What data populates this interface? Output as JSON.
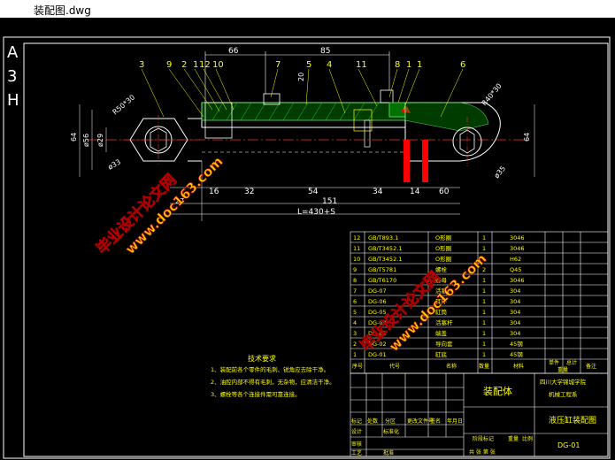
{
  "window": {
    "title": "装配图.dwg"
  },
  "sheet": {
    "format_letters": [
      "A",
      "3",
      "H"
    ]
  },
  "balloons": [
    "3",
    "9",
    "2",
    "1",
    "12",
    "10",
    "7",
    "5",
    "4",
    "11",
    "8",
    "1",
    "1",
    "6"
  ],
  "dimensions": {
    "d66": "66",
    "d85": "85",
    "d20": "20",
    "r_left": "R50*30",
    "r_right": "R40*30",
    "d64_left": "64",
    "d56": "ø56",
    "d29": "ø29",
    "d33": "ø33",
    "d64_right": "64",
    "d35": "ø35",
    "b27": "27",
    "b16": "16",
    "b32": "32",
    "b54": "54",
    "b34": "34",
    "b14": "14",
    "b60": "60",
    "d151": "151",
    "total": "L=430+S"
  },
  "watermark": {
    "line1": "毕业设计论文网",
    "line2": "www.doc163.com"
  },
  "parts_table": {
    "rows": [
      {
        "no": "12",
        "code": "GB/T893.1",
        "name": "O形圈",
        "qty": "1",
        "mat": "3046"
      },
      {
        "no": "11",
        "code": "GB/T3452.1",
        "name": "O形圈",
        "qty": "1",
        "mat": "3046"
      },
      {
        "no": "10",
        "code": "GB/T3452.1",
        "name": "O形圈",
        "qty": "1",
        "mat": "H62"
      },
      {
        "no": "9",
        "code": "GB/T5781",
        "name": "螺栓",
        "qty": "2",
        "mat": "Q45"
      },
      {
        "no": "8",
        "code": "GB/T6170",
        "name": "螺母",
        "qty": "1",
        "mat": "3046"
      },
      {
        "no": "7",
        "code": "DG-07",
        "name": "活塞",
        "qty": "1",
        "mat": "304"
      },
      {
        "no": "6",
        "code": "DG-06",
        "name": "耳环",
        "qty": "1",
        "mat": "304"
      },
      {
        "no": "5",
        "code": "DG-05",
        "name": "缸筒",
        "qty": "1",
        "mat": "304"
      },
      {
        "no": "4",
        "code": "DG-04",
        "name": "活塞杆",
        "qty": "1",
        "mat": "304"
      },
      {
        "no": "3",
        "code": "DG-03",
        "name": "端盖",
        "qty": "1",
        "mat": "304"
      },
      {
        "no": "2",
        "code": "DG-02",
        "name": "导向套",
        "qty": "1",
        "mat": "45钢"
      },
      {
        "no": "1",
        "code": "DG-01",
        "name": "缸底",
        "qty": "1",
        "mat": "45钢"
      }
    ],
    "header": {
      "no": "序号",
      "code": "代号",
      "name": "名称",
      "qty": "数量",
      "mat": "材料",
      "weight_single": "单件",
      "weight_total": "总计",
      "weight_label": "重量",
      "remark": "备注"
    }
  },
  "tech_req": {
    "heading": "技术要求",
    "items": [
      "1、装配前各个零件的毛刺、锐角应去除干净。",
      "2、油腔内部不得有毛刺，无杂物，应清洁干净。",
      "3、螺栓等各个连接件需可靠连接。"
    ]
  },
  "title_block": {
    "drawing_name": "装配体",
    "school": "四川大学锦城学院",
    "dept": "机械工程系",
    "title": "液压缸装配图",
    "code": "DG-01",
    "marks": [
      "标记",
      "处数",
      "分区",
      "更改文件号",
      "签名",
      "年月日"
    ],
    "roles": [
      "设计",
      "标准化",
      "审核",
      "工艺",
      "批准"
    ],
    "stage_label": "阶段标记",
    "weight_label": "重量",
    "scale_label": "比例",
    "sheets_label": "共 张 第 张"
  }
}
